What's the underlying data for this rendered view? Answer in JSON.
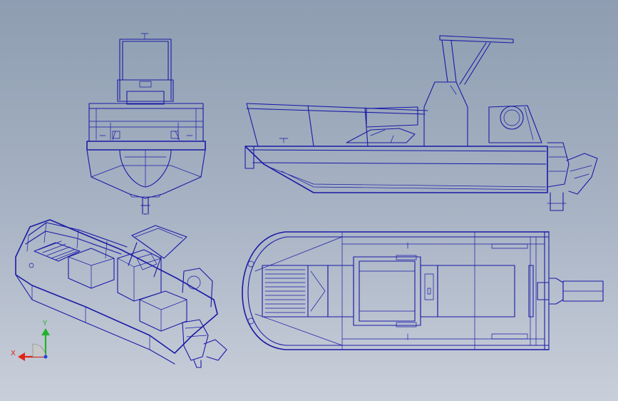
{
  "views": [
    {
      "id": "front",
      "kind": "orthographic"
    },
    {
      "id": "side",
      "kind": "orthographic"
    },
    {
      "id": "isometric",
      "kind": "axonometric"
    },
    {
      "id": "top",
      "kind": "orthographic"
    }
  ],
  "triad": {
    "x_label": "X",
    "y_label": "Y",
    "x_color": "#e0241b",
    "y_color": "#20b32a",
    "z_color": "#2040e0"
  },
  "colors": {
    "line": "#1a1aa6",
    "background_top": "#8e9db1",
    "background_bottom": "#c9cfda"
  }
}
